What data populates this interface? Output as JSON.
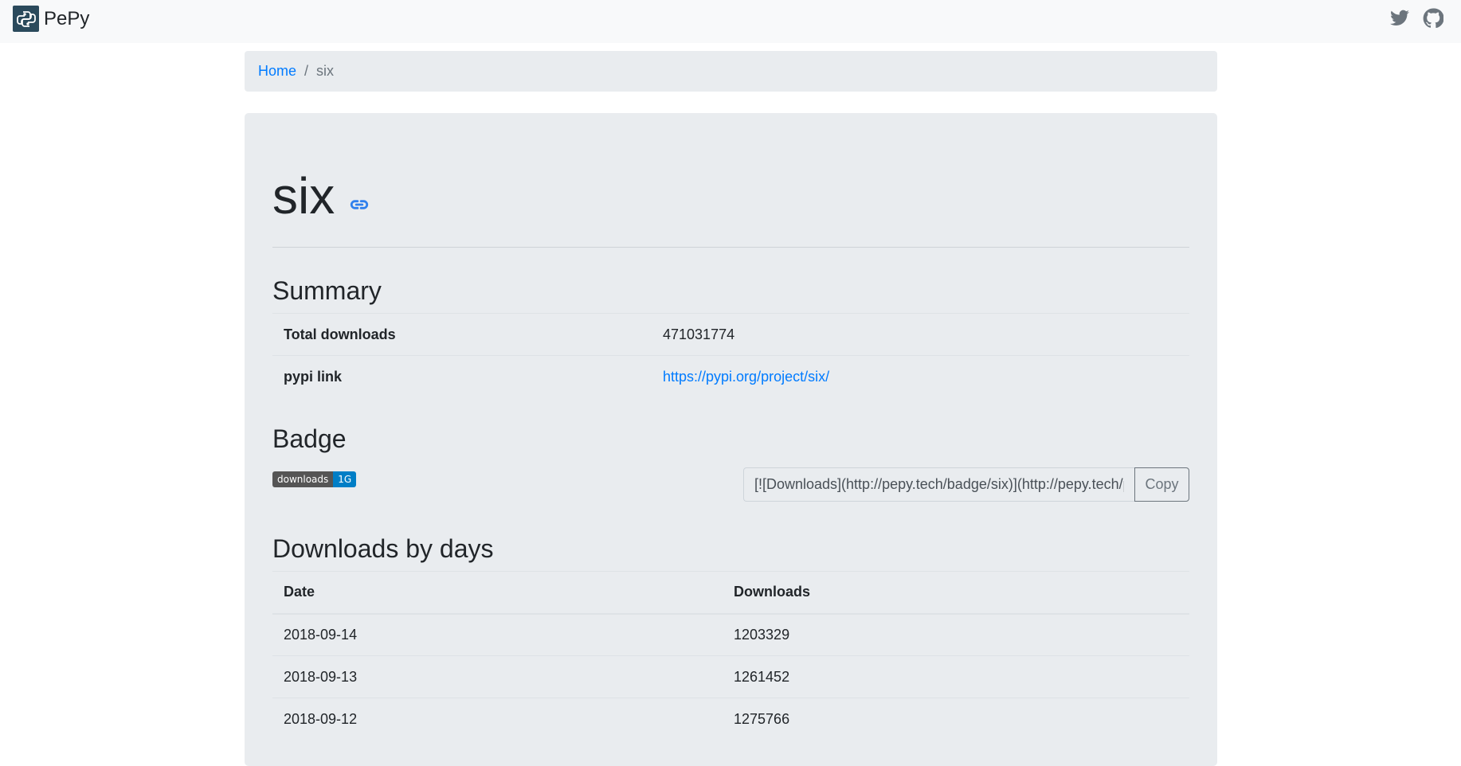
{
  "navbar": {
    "brand": "PePy",
    "icons": [
      "python-logo-icon",
      "twitter-icon",
      "github-icon"
    ]
  },
  "breadcrumb": {
    "home": "Home",
    "separator": "/",
    "current": "six"
  },
  "package": {
    "name": "six",
    "link_icon": "link-icon"
  },
  "summary": {
    "heading": "Summary",
    "rows": [
      {
        "label": "Total downloads",
        "value": "471031774"
      },
      {
        "label": "pypi link",
        "value": "https://pypi.org/project/six/"
      }
    ]
  },
  "badge": {
    "heading": "Badge",
    "label": "downloads",
    "value": "1G",
    "markdown": "[![Downloads](http://pepy.tech/badge/six)](http://pepy.tech/project/six)",
    "copy_label": "Copy"
  },
  "downloads_by_days": {
    "heading": "Downloads by days",
    "columns": [
      "Date",
      "Downloads"
    ],
    "rows": [
      {
        "date": "2018-09-14",
        "downloads": "1203329"
      },
      {
        "date": "2018-09-13",
        "downloads": "1261452"
      },
      {
        "date": "2018-09-12",
        "downloads": "1275766"
      }
    ]
  },
  "colors": {
    "link": "#007bff",
    "navbar_bg": "#f8f9fa",
    "panel_bg": "#e9ecef",
    "badge_left": "#555555",
    "badge_right": "#007ec6"
  }
}
